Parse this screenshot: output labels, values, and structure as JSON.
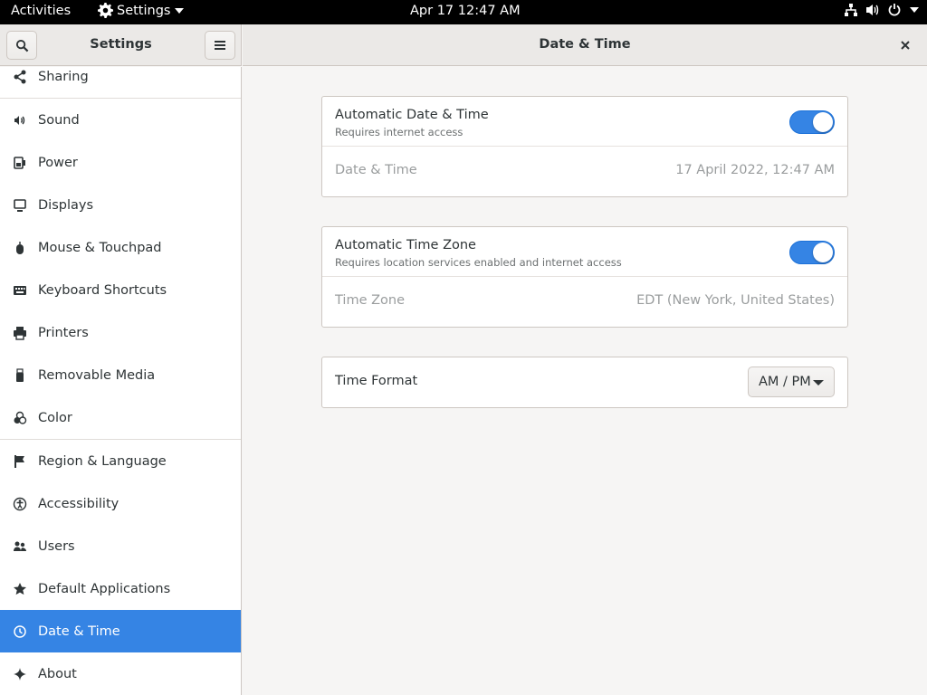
{
  "topbar": {
    "activities": "Activities",
    "app_menu": "Settings",
    "clock": "Apr 17  12:47 AM"
  },
  "sidebar": {
    "title": "Settings",
    "items": [
      {
        "label": "Sharing",
        "icon": "share-icon"
      },
      {
        "label": "Sound",
        "icon": "speaker-icon"
      },
      {
        "label": "Power",
        "icon": "battery-icon"
      },
      {
        "label": "Displays",
        "icon": "display-icon"
      },
      {
        "label": "Mouse & Touchpad",
        "icon": "mouse-icon"
      },
      {
        "label": "Keyboard Shortcuts",
        "icon": "keyboard-icon"
      },
      {
        "label": "Printers",
        "icon": "printer-icon"
      },
      {
        "label": "Removable Media",
        "icon": "usb-drive-icon"
      },
      {
        "label": "Color",
        "icon": "color-icon"
      },
      {
        "label": "Region & Language",
        "icon": "flag-icon"
      },
      {
        "label": "Accessibility",
        "icon": "accessibility-icon"
      },
      {
        "label": "Users",
        "icon": "users-icon"
      },
      {
        "label": "Default Applications",
        "icon": "star-icon"
      },
      {
        "label": "Date & Time",
        "icon": "clock-icon",
        "selected": true
      },
      {
        "label": "About",
        "icon": "sparkle-icon"
      }
    ]
  },
  "main": {
    "title": "Date & Time",
    "auto_datetime": {
      "label": "Automatic Date & Time",
      "sublabel": "Requires internet access",
      "enabled": true
    },
    "datetime": {
      "label": "Date & Time",
      "value": "17 April 2022, 12:47 AM"
    },
    "auto_timezone": {
      "label": "Automatic Time Zone",
      "sublabel": "Requires location services enabled and internet access",
      "enabled": true
    },
    "timezone": {
      "label": "Time Zone",
      "value": "EDT (New York, United States)"
    },
    "time_format": {
      "label": "Time Format",
      "value": "AM / PM"
    }
  },
  "colors": {
    "accent": "#3584e4",
    "header_bg": "#ebe9e7",
    "window_bg": "#f6f5f4"
  }
}
